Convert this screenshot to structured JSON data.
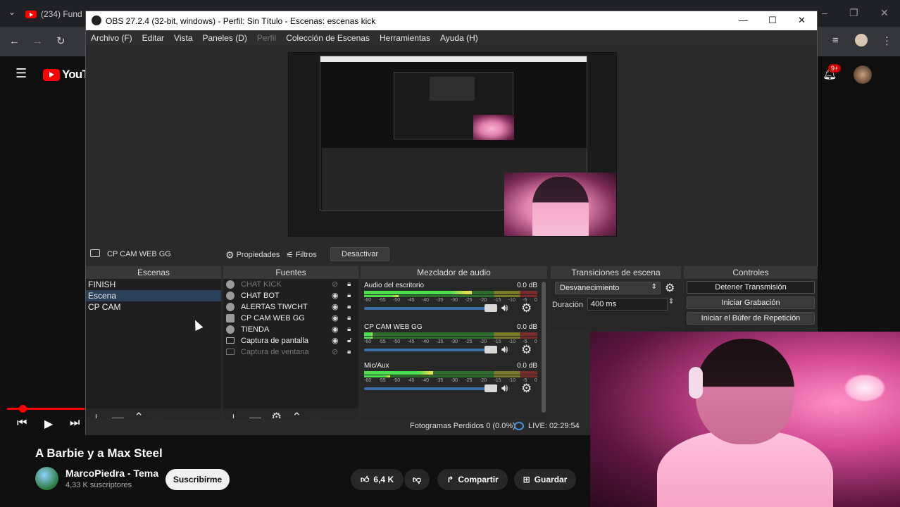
{
  "browser": {
    "tab_label": "(234) Fund",
    "window_controls": [
      "–",
      "❐",
      "✕"
    ]
  },
  "youtube": {
    "logo_text": "YouTube",
    "notif_badge": "9+",
    "video_title": "A Barbie y a Max Steel",
    "channel_name": "MarcoPiedra - Tema",
    "subscribers": "4,33 K suscriptores",
    "subscribe_label": "Suscribirme",
    "likes": "6,4 K",
    "share_label": "Compartir",
    "save_label": "Guardar"
  },
  "obs": {
    "title": "OBS 27.2.4 (32-bit, windows) - Perfil: Sin Título - Escenas: escenas kick",
    "menu": [
      {
        "label": "Archivo (F)",
        "disabled": false
      },
      {
        "label": "Editar",
        "disabled": false
      },
      {
        "label": "Vista",
        "disabled": false
      },
      {
        "label": "Paneles (D)",
        "disabled": false
      },
      {
        "label": "Perfil",
        "disabled": true
      },
      {
        "label": "Colección de Escenas",
        "disabled": false
      },
      {
        "label": "Herramientas",
        "disabled": false
      },
      {
        "label": "Ayuda (H)",
        "disabled": false
      }
    ],
    "source_toolbar": {
      "selected_source": "CP CAM WEB GG",
      "properties_label": "Propiedades",
      "filters_label": "Filtros",
      "deactivate_label": "Desactivar"
    },
    "docks": {
      "scenes_title": "Escenas",
      "sources_title": "Fuentes",
      "mixer_title": "Mezclador de audio",
      "transitions_title": "Transiciones de escena",
      "controls_title": "Controles"
    },
    "scenes": [
      {
        "name": "FINISH",
        "selected": false
      },
      {
        "name": "Escena",
        "selected": true
      },
      {
        "name": "CP CAM",
        "selected": false
      }
    ],
    "sources": [
      {
        "name": "CHAT KICK",
        "icon": "globe-icon",
        "visible": false
      },
      {
        "name": "CHAT BOT",
        "icon": "globe-icon",
        "visible": true
      },
      {
        "name": "ALERTAS TIWCHT",
        "icon": "globe-icon",
        "visible": true
      },
      {
        "name": "CP CAM WEB GG",
        "icon": "camera-icon",
        "visible": true
      },
      {
        "name": "TIENDA",
        "icon": "globe-icon",
        "visible": true
      },
      {
        "name": "Captura de pantalla",
        "icon": "monitor-icon",
        "visible": true
      },
      {
        "name": "Captura de ventana",
        "icon": "window-icon",
        "visible": false
      }
    ],
    "mixer": [
      {
        "name": "Audio del escritorio",
        "db": "0.0 dB",
        "level": 0.62,
        "level2": 0.2
      },
      {
        "name": "CP CAM WEB GG",
        "db": "0.0 dB",
        "level": 0.05,
        "level2": 0.05
      },
      {
        "name": "Mic/Aux",
        "db": "0.0 dB",
        "level": 0.4,
        "level2": 0.15
      }
    ],
    "meter_ticks": [
      "-60",
      "-55",
      "-50",
      "-45",
      "-40",
      "-35",
      "-30",
      "-25",
      "-20",
      "-15",
      "-10",
      "-5",
      "0"
    ],
    "transitions": {
      "selected": "Desvanecimiento",
      "duration_label": "Duración",
      "duration_value": "400 ms"
    },
    "controls": [
      {
        "label": "Detener Transmisión",
        "active": true
      },
      {
        "label": "Iniciar Grabación",
        "active": false
      },
      {
        "label": "Iniciar el Búfer de Repetición",
        "active": false
      }
    ],
    "status": {
      "dropped_frames": "Fotogramas Perdidos 0 (0.0%)",
      "live": "LIVE: 02:29:54"
    }
  },
  "colors": {
    "youtube_red": "#ff0000",
    "obs_selection": "#2a3f58",
    "volume_blue": "#3c6fa8",
    "webcam_pink": "#e07fad"
  }
}
